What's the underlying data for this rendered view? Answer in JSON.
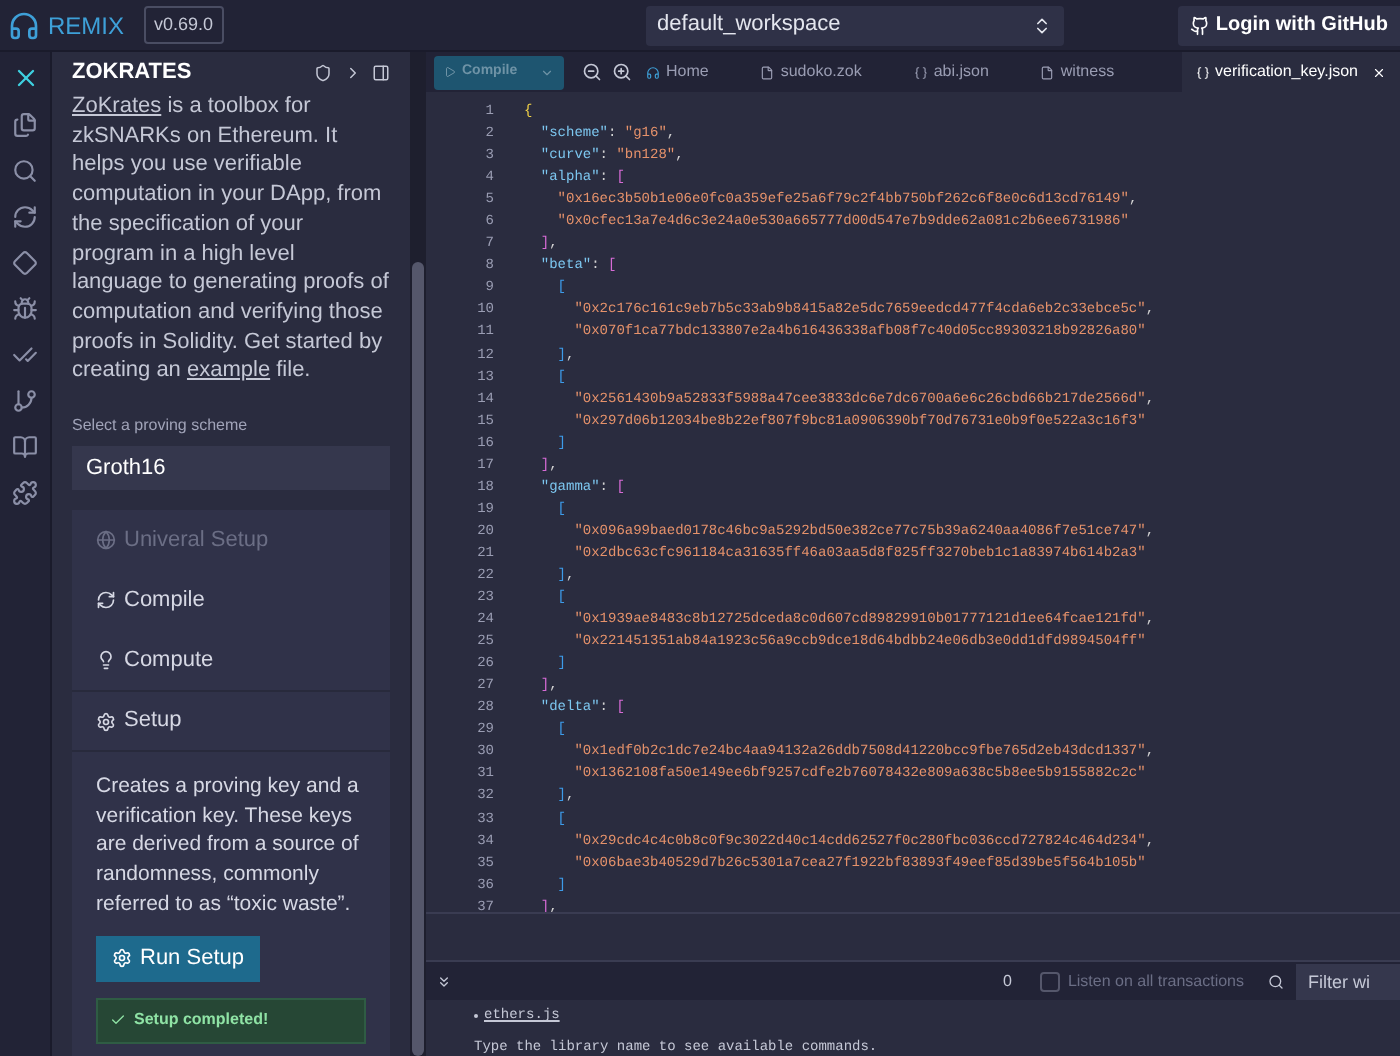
{
  "topbar": {
    "brand": "REMIX",
    "version": "v0.69.0",
    "workspace": "default_workspace",
    "login": "Login with GitHub"
  },
  "panel": {
    "title": "ZOKRATES",
    "intro": [
      {
        "kind": "link",
        "text": "ZoKrates"
      },
      {
        "kind": "text",
        "text": " is a toolbox for zkSNARKs on Ethereum. It helps you use verifiable computation in your DApp, from the specification of your program in a high level language to generating proofs of computation and verifying those proofs in Solidity. Get started by creating an "
      },
      {
        "kind": "link",
        "text": "example"
      },
      {
        "kind": "text",
        "text": " file."
      }
    ],
    "scheme_label": "Select a proving scheme",
    "scheme": "Groth16",
    "steps": [
      {
        "label": "Univeral Setup",
        "disabled": true,
        "expanded": false
      },
      {
        "label": "Compile",
        "disabled": false,
        "expanded": false
      },
      {
        "label": "Compute",
        "disabled": false,
        "expanded": false
      },
      {
        "label": "Setup",
        "disabled": false,
        "expanded": true,
        "description": "Creates a proving key and a verification key.  These keys are derived from a source of randomness, commonly referred to as “toxic waste”.",
        "button": "Run Setup",
        "alert": "Setup completed!"
      }
    ]
  },
  "editor": {
    "compile": "Compile",
    "tabs": [
      {
        "label": "Home",
        "kind": "home",
        "selected": false
      },
      {
        "label": "sudoko.zok",
        "kind": "file",
        "selected": false
      },
      {
        "label": "abi.json",
        "kind": "json",
        "selected": false
      },
      {
        "label": "witness",
        "kind": "file",
        "selected": false
      },
      {
        "label": "verification_key.json",
        "kind": "json",
        "selected": true
      }
    ],
    "lines": [
      {
        "n": "1",
        "kind": "top",
        "t": [
          {
            "kind": "brace",
            "text": "{"
          }
        ]
      },
      {
        "n": "2",
        "kind": "key",
        "t": [
          {
            "kind": "key",
            "text": "\"scheme\""
          },
          {
            "kind": "punct",
            "text": ":"
          },
          {
            "kind": "string",
            "text": "\"g16\""
          },
          {
            "kind": "punct",
            "text": ","
          }
        ]
      },
      {
        "n": "3",
        "kind": "key",
        "t": [
          {
            "kind": "key",
            "text": "\"curve\""
          },
          {
            "kind": "punct",
            "text": ":"
          },
          {
            "kind": "string",
            "text": "\"bn128\""
          },
          {
            "kind": "punct",
            "text": ","
          }
        ]
      },
      {
        "n": "4",
        "kind": "key",
        "t": [
          {
            "kind": "key",
            "text": "\"alpha\""
          },
          {
            "kind": "punct",
            "text": ":"
          },
          {
            "kind": "outer",
            "text": "["
          }
        ]
      },
      {
        "n": "5",
        "kind": "sub",
        "t": [
          {
            "kind": "string",
            "text": "\"0x16ec3b50b1e06e0fc0a359efe25a6f79c2f4bb750bf262c6f8e0c6d13cd76149\""
          },
          {
            "kind": "punct",
            "text": ","
          }
        ]
      },
      {
        "n": "6",
        "kind": "sub",
        "t": [
          {
            "kind": "string",
            "text": "\"0x0cfec13a7e4d6c3e24a0e530a665777d00d547e7b9dde62a081c2b6ee6731986\""
          }
        ]
      },
      {
        "n": "7",
        "kind": "key",
        "t": [
          {
            "kind": "outer",
            "text": "]"
          },
          {
            "kind": "punct",
            "text": ","
          }
        ]
      },
      {
        "n": "8",
        "kind": "key",
        "t": [
          {
            "kind": "key",
            "text": "\"beta\""
          },
          {
            "kind": "punct",
            "text": ":"
          },
          {
            "kind": "outer",
            "text": "["
          }
        ]
      },
      {
        "n": "9",
        "kind": "sub",
        "t": [
          {
            "kind": "inner",
            "text": "["
          }
        ]
      },
      {
        "n": "10",
        "kind": "leaf",
        "t": [
          {
            "kind": "string",
            "text": "\"0x2c176c161c9eb7b5c33ab9b8415a82e5dc7659eedcd477f4cda6eb2c33ebce5c\""
          },
          {
            "kind": "punct",
            "text": ","
          }
        ]
      },
      {
        "n": "11",
        "kind": "leaf",
        "t": [
          {
            "kind": "string",
            "text": "\"0x070f1ca77bdc133807e2a4b616436338afb08f7c40d05cc89303218b92826a80\""
          }
        ]
      },
      {
        "n": "12",
        "kind": "sub",
        "t": [
          {
            "kind": "inner",
            "text": "]"
          },
          {
            "kind": "punct",
            "text": ","
          }
        ]
      },
      {
        "n": "13",
        "kind": "sub",
        "t": [
          {
            "kind": "inner",
            "text": "["
          }
        ]
      },
      {
        "n": "14",
        "kind": "leaf",
        "t": [
          {
            "kind": "string",
            "text": "\"0x2561430b9a52833f5988a47cee3833dc6e7dc6700a6e6c26cbd66b217de2566d\""
          },
          {
            "kind": "punct",
            "text": ","
          }
        ]
      },
      {
        "n": "15",
        "kind": "leaf",
        "t": [
          {
            "kind": "string",
            "text": "\"0x297d06b12034be8b22ef807f9bc81a0906390bf70d76731e0b9f0e522a3c16f3\""
          }
        ]
      },
      {
        "n": "16",
        "kind": "sub",
        "t": [
          {
            "kind": "inner",
            "text": "]"
          }
        ]
      },
      {
        "n": "17",
        "kind": "key",
        "t": [
          {
            "kind": "outer",
            "text": "]"
          },
          {
            "kind": "punct",
            "text": ","
          }
        ]
      },
      {
        "n": "18",
        "kind": "key",
        "t": [
          {
            "kind": "key",
            "text": "\"gamma\""
          },
          {
            "kind": "punct",
            "text": ":"
          },
          {
            "kind": "outer",
            "text": "["
          }
        ]
      },
      {
        "n": "19",
        "kind": "sub",
        "t": [
          {
            "kind": "inner",
            "text": "["
          }
        ]
      },
      {
        "n": "20",
        "kind": "leaf",
        "t": [
          {
            "kind": "string",
            "text": "\"0x096a99baed0178c46bc9a5292bd50e382ce77c75b39a6240aa4086f7e51ce747\""
          },
          {
            "kind": "punct",
            "text": ","
          }
        ]
      },
      {
        "n": "21",
        "kind": "leaf",
        "t": [
          {
            "kind": "string",
            "text": "\"0x2dbc63cfc961184ca31635ff46a03aa5d8f825ff3270beb1c1a83974b614b2a3\""
          }
        ]
      },
      {
        "n": "22",
        "kind": "sub",
        "t": [
          {
            "kind": "inner",
            "text": "]"
          },
          {
            "kind": "punct",
            "text": ","
          }
        ]
      },
      {
        "n": "23",
        "kind": "sub",
        "t": [
          {
            "kind": "inner",
            "text": "["
          }
        ]
      },
      {
        "n": "24",
        "kind": "leaf",
        "t": [
          {
            "kind": "string",
            "text": "\"0x1939ae8483c8b12725dceda8c0d607cd89829910b01777121d1ee64fcae121fd\""
          },
          {
            "kind": "punct",
            "text": ","
          }
        ]
      },
      {
        "n": "25",
        "kind": "leaf",
        "t": [
          {
            "kind": "string",
            "text": "\"0x221451351ab84a1923c56a9ccb9dce18d64bdbb24e06db3e0dd1dfd9894504ff\""
          }
        ]
      },
      {
        "n": "26",
        "kind": "sub",
        "t": [
          {
            "kind": "inner",
            "text": "]"
          }
        ]
      },
      {
        "n": "27",
        "kind": "key",
        "t": [
          {
            "kind": "outer",
            "text": "]"
          },
          {
            "kind": "punct",
            "text": ","
          }
        ]
      },
      {
        "n": "28",
        "kind": "key",
        "t": [
          {
            "kind": "key",
            "text": "\"delta\""
          },
          {
            "kind": "punct",
            "text": ":"
          },
          {
            "kind": "outer",
            "text": "["
          }
        ]
      },
      {
        "n": "29",
        "kind": "sub",
        "t": [
          {
            "kind": "inner",
            "text": "["
          }
        ]
      },
      {
        "n": "30",
        "kind": "leaf",
        "t": [
          {
            "kind": "string",
            "text": "\"0x1edf0b2c1dc7e24bc4aa94132a26ddb7508d41220bcc9fbe765d2eb43dcd1337\""
          },
          {
            "kind": "punct",
            "text": ","
          }
        ]
      },
      {
        "n": "31",
        "kind": "leaf",
        "t": [
          {
            "kind": "string",
            "text": "\"0x1362108fa50e149ee6bf9257cdfe2b76078432e809a638c5b8ee5b9155882c2c\""
          }
        ]
      },
      {
        "n": "32",
        "kind": "sub",
        "t": [
          {
            "kind": "inner",
            "text": "]"
          },
          {
            "kind": "punct",
            "text": ","
          }
        ]
      },
      {
        "n": "33",
        "kind": "sub",
        "t": [
          {
            "kind": "inner",
            "text": "["
          }
        ]
      },
      {
        "n": "34",
        "kind": "leaf",
        "t": [
          {
            "kind": "string",
            "text": "\"0x29cdc4c4c0b8c0f9c3022d40c14cdd62527f0c280fbc036ccd727824c464d234\""
          },
          {
            "kind": "punct",
            "text": ","
          }
        ]
      },
      {
        "n": "35",
        "kind": "leaf",
        "t": [
          {
            "kind": "string",
            "text": "\"0x06bae3b40529d7b26c5301a7cea27f1922bf83893f49eef85d39be5f564b105b\""
          }
        ]
      },
      {
        "n": "36",
        "kind": "sub",
        "t": [
          {
            "kind": "inner",
            "text": "]"
          }
        ]
      },
      {
        "n": "37",
        "kind": "key",
        "t": [
          {
            "kind": "outer",
            "text": "]"
          },
          {
            "kind": "punct",
            "text": ","
          }
        ]
      }
    ]
  },
  "terminal": {
    "count": "0",
    "listen": {
      "label": "Listen on all transactions",
      "checked": false
    },
    "filter_placeholder": "Filter wi",
    "library": "ethers.js",
    "hint": "Type the library name to see available commands."
  }
}
